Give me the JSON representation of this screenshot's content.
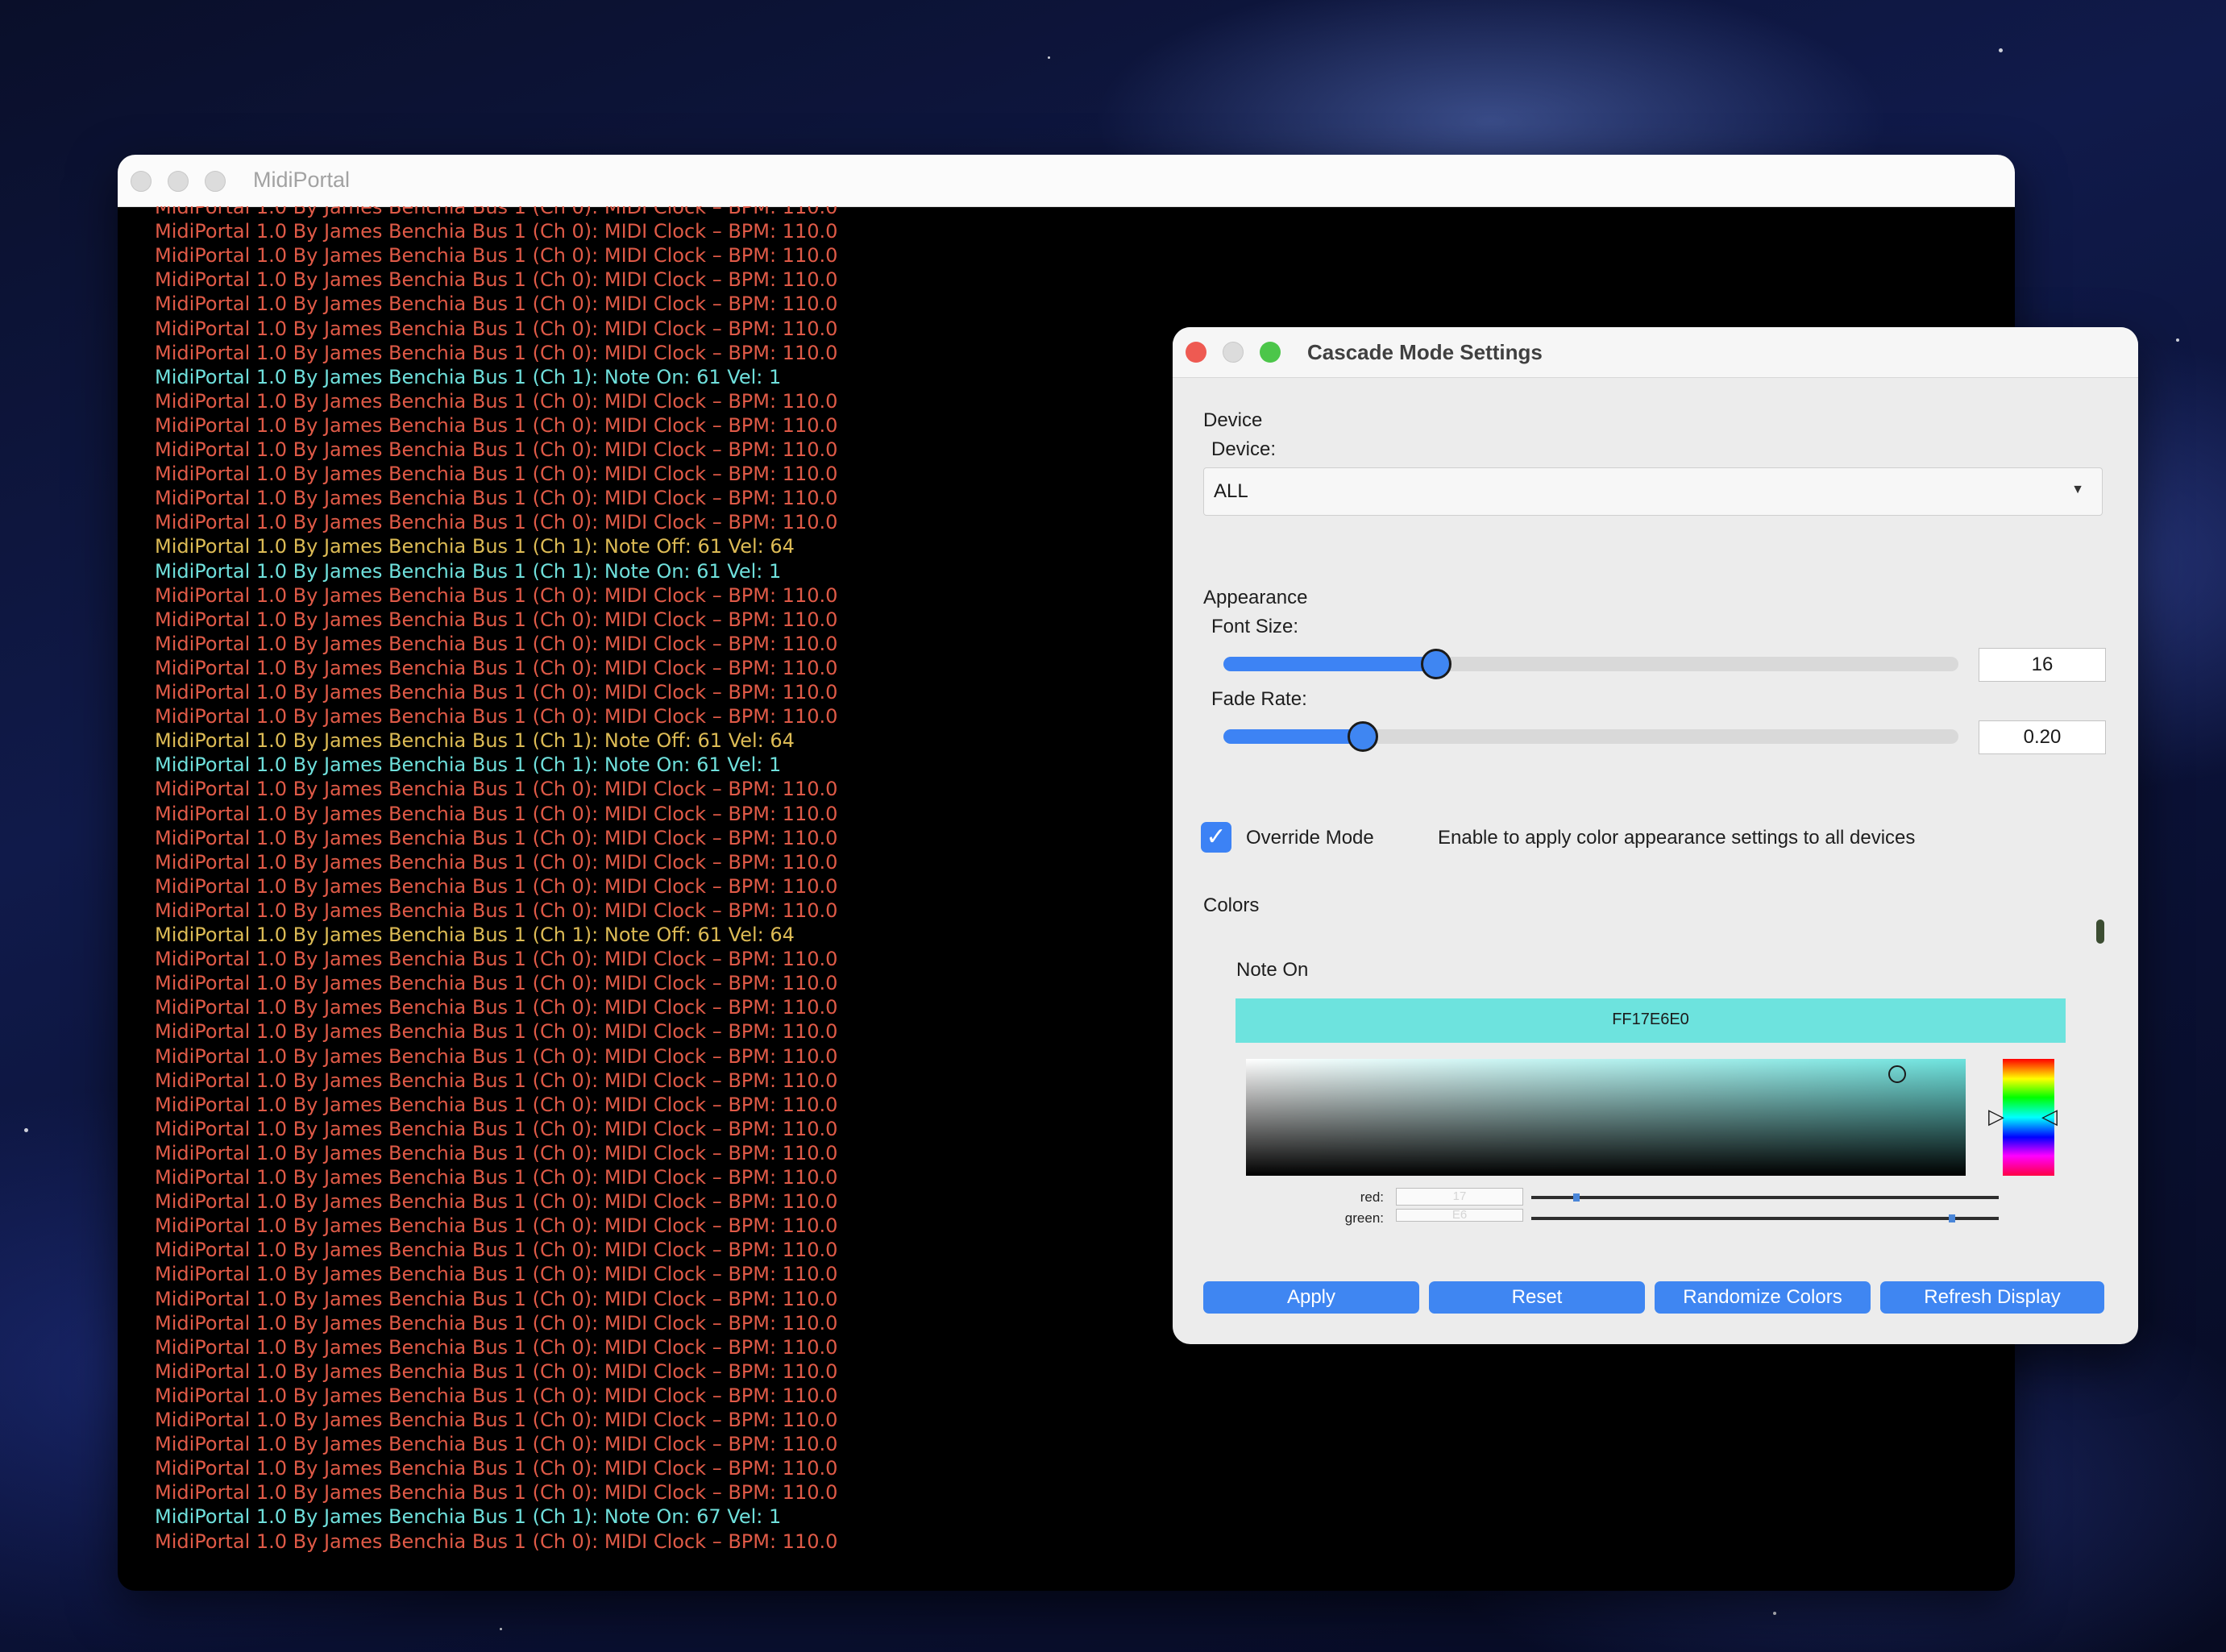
{
  "colors": {
    "clock": "#e05a47",
    "note_on": "#6fe0dc",
    "note_off": "#ddbb55",
    "accent": "#3f86f2"
  },
  "main_window": {
    "title": "MidiPortal",
    "log_lines": [
      {
        "text": "MidiPortal 1.0 By James Benchia Bus 1 (Ch 0): MIDI Clock – BPM: 110.0",
        "type": "clock"
      },
      {
        "text": "MidiPortal 1.0 By James Benchia Bus 1 (Ch 0): MIDI Clock – BPM: 110.0",
        "type": "clock"
      },
      {
        "text": "MidiPortal 1.0 By James Benchia Bus 1 (Ch 0): MIDI Clock – BPM: 110.0",
        "type": "clock"
      },
      {
        "text": "MidiPortal 1.0 By James Benchia Bus 1 (Ch 0): MIDI Clock – BPM: 110.0",
        "type": "clock"
      },
      {
        "text": "MidiPortal 1.0 By James Benchia Bus 1 (Ch 0): MIDI Clock – BPM: 110.0",
        "type": "clock"
      },
      {
        "text": "MidiPortal 1.0 By James Benchia Bus 1 (Ch 0): MIDI Clock – BPM: 110.0",
        "type": "clock"
      },
      {
        "text": "MidiPortal 1.0 By James Benchia Bus 1 (Ch 0): MIDI Clock – BPM: 110.0",
        "type": "clock"
      },
      {
        "text": "MidiPortal 1.0 By James Benchia Bus 1 (Ch 1): Note On: 61 Vel: 1",
        "type": "note_on"
      },
      {
        "text": "MidiPortal 1.0 By James Benchia Bus 1 (Ch 0): MIDI Clock – BPM: 110.0",
        "type": "clock"
      },
      {
        "text": "MidiPortal 1.0 By James Benchia Bus 1 (Ch 0): MIDI Clock – BPM: 110.0",
        "type": "clock"
      },
      {
        "text": "MidiPortal 1.0 By James Benchia Bus 1 (Ch 0): MIDI Clock – BPM: 110.0",
        "type": "clock"
      },
      {
        "text": "MidiPortal 1.0 By James Benchia Bus 1 (Ch 0): MIDI Clock – BPM: 110.0",
        "type": "clock"
      },
      {
        "text": "MidiPortal 1.0 By James Benchia Bus 1 (Ch 0): MIDI Clock – BPM: 110.0",
        "type": "clock"
      },
      {
        "text": "MidiPortal 1.0 By James Benchia Bus 1 (Ch 0): MIDI Clock – BPM: 110.0",
        "type": "clock"
      },
      {
        "text": "MidiPortal 1.0 By James Benchia Bus 1 (Ch 1): Note Off: 61 Vel: 64",
        "type": "note_off"
      },
      {
        "text": "MidiPortal 1.0 By James Benchia Bus 1 (Ch 1): Note On: 61 Vel: 1",
        "type": "note_on"
      },
      {
        "text": "MidiPortal 1.0 By James Benchia Bus 1 (Ch 0): MIDI Clock – BPM: 110.0",
        "type": "clock"
      },
      {
        "text": "MidiPortal 1.0 By James Benchia Bus 1 (Ch 0): MIDI Clock – BPM: 110.0",
        "type": "clock"
      },
      {
        "text": "MidiPortal 1.0 By James Benchia Bus 1 (Ch 0): MIDI Clock – BPM: 110.0",
        "type": "clock"
      },
      {
        "text": "MidiPortal 1.0 By James Benchia Bus 1 (Ch 0): MIDI Clock – BPM: 110.0",
        "type": "clock"
      },
      {
        "text": "MidiPortal 1.0 By James Benchia Bus 1 (Ch 0): MIDI Clock – BPM: 110.0",
        "type": "clock"
      },
      {
        "text": "MidiPortal 1.0 By James Benchia Bus 1 (Ch 0): MIDI Clock – BPM: 110.0",
        "type": "clock"
      },
      {
        "text": "MidiPortal 1.0 By James Benchia Bus 1 (Ch 1): Note Off: 61 Vel: 64",
        "type": "note_off"
      },
      {
        "text": "MidiPortal 1.0 By James Benchia Bus 1 (Ch 1): Note On: 61 Vel: 1",
        "type": "note_on"
      },
      {
        "text": "MidiPortal 1.0 By James Benchia Bus 1 (Ch 0): MIDI Clock – BPM: 110.0",
        "type": "clock"
      },
      {
        "text": "MidiPortal 1.0 By James Benchia Bus 1 (Ch 0): MIDI Clock – BPM: 110.0",
        "type": "clock"
      },
      {
        "text": "MidiPortal 1.0 By James Benchia Bus 1 (Ch 0): MIDI Clock – BPM: 110.0",
        "type": "clock"
      },
      {
        "text": "MidiPortal 1.0 By James Benchia Bus 1 (Ch 0): MIDI Clock – BPM: 110.0",
        "type": "clock"
      },
      {
        "text": "MidiPortal 1.0 By James Benchia Bus 1 (Ch 0): MIDI Clock – BPM: 110.0",
        "type": "clock"
      },
      {
        "text": "MidiPortal 1.0 By James Benchia Bus 1 (Ch 0): MIDI Clock – BPM: 110.0",
        "type": "clock"
      },
      {
        "text": "MidiPortal 1.0 By James Benchia Bus 1 (Ch 1): Note Off: 61 Vel: 64",
        "type": "note_off"
      },
      {
        "text": "MidiPortal 1.0 By James Benchia Bus 1 (Ch 0): MIDI Clock – BPM: 110.0",
        "type": "clock"
      },
      {
        "text": "MidiPortal 1.0 By James Benchia Bus 1 (Ch 0): MIDI Clock – BPM: 110.0",
        "type": "clock"
      },
      {
        "text": "MidiPortal 1.0 By James Benchia Bus 1 (Ch 0): MIDI Clock – BPM: 110.0",
        "type": "clock"
      },
      {
        "text": "MidiPortal 1.0 By James Benchia Bus 1 (Ch 0): MIDI Clock – BPM: 110.0",
        "type": "clock"
      },
      {
        "text": "MidiPortal 1.0 By James Benchia Bus 1 (Ch 0): MIDI Clock – BPM: 110.0",
        "type": "clock"
      },
      {
        "text": "MidiPortal 1.0 By James Benchia Bus 1 (Ch 0): MIDI Clock – BPM: 110.0",
        "type": "clock"
      },
      {
        "text": "MidiPortal 1.0 By James Benchia Bus 1 (Ch 0): MIDI Clock – BPM: 110.0",
        "type": "clock"
      },
      {
        "text": "MidiPortal 1.0 By James Benchia Bus 1 (Ch 0): MIDI Clock – BPM: 110.0",
        "type": "clock"
      },
      {
        "text": "MidiPortal 1.0 By James Benchia Bus 1 (Ch 0): MIDI Clock – BPM: 110.0",
        "type": "clock"
      },
      {
        "text": "MidiPortal 1.0 By James Benchia Bus 1 (Ch 0): MIDI Clock – BPM: 110.0",
        "type": "clock"
      },
      {
        "text": "MidiPortal 1.0 By James Benchia Bus 1 (Ch 0): MIDI Clock – BPM: 110.0",
        "type": "clock"
      },
      {
        "text": "MidiPortal 1.0 By James Benchia Bus 1 (Ch 0): MIDI Clock – BPM: 110.0",
        "type": "clock"
      },
      {
        "text": "MidiPortal 1.0 By James Benchia Bus 1 (Ch 0): MIDI Clock – BPM: 110.0",
        "type": "clock"
      },
      {
        "text": "MidiPortal 1.0 By James Benchia Bus 1 (Ch 0): MIDI Clock – BPM: 110.0",
        "type": "clock"
      },
      {
        "text": "MidiPortal 1.0 By James Benchia Bus 1 (Ch 0): MIDI Clock – BPM: 110.0",
        "type": "clock"
      },
      {
        "text": "MidiPortal 1.0 By James Benchia Bus 1 (Ch 0): MIDI Clock – BPM: 110.0",
        "type": "clock"
      },
      {
        "text": "MidiPortal 1.0 By James Benchia Bus 1 (Ch 0): MIDI Clock – BPM: 110.0",
        "type": "clock"
      },
      {
        "text": "MidiPortal 1.0 By James Benchia Bus 1 (Ch 0): MIDI Clock – BPM: 110.0",
        "type": "clock"
      },
      {
        "text": "MidiPortal 1.0 By James Benchia Bus 1 (Ch 0): MIDI Clock – BPM: 110.0",
        "type": "clock"
      },
      {
        "text": "MidiPortal 1.0 By James Benchia Bus 1 (Ch 0): MIDI Clock – BPM: 110.0",
        "type": "clock"
      },
      {
        "text": "MidiPortal 1.0 By James Benchia Bus 1 (Ch 0): MIDI Clock – BPM: 110.0",
        "type": "clock"
      },
      {
        "text": "MidiPortal 1.0 By James Benchia Bus 1 (Ch 0): MIDI Clock – BPM: 110.0",
        "type": "clock"
      },
      {
        "text": "MidiPortal 1.0 By James Benchia Bus 1 (Ch 0): MIDI Clock – BPM: 110.0",
        "type": "clock"
      },
      {
        "text": "MidiPortal 1.0 By James Benchia Bus 1 (Ch 1): Note On: 67 Vel: 1",
        "type": "note_on"
      },
      {
        "text": "MidiPortal 1.0 By James Benchia Bus 1 (Ch 0): MIDI Clock – BPM: 110.0",
        "type": "clock"
      }
    ]
  },
  "dialog": {
    "title": "Cascade Mode Settings",
    "device_section": "Device",
    "device_label": "Device:",
    "device_value": "ALL",
    "appearance_section": "Appearance",
    "font_size_label": "Font Size:",
    "font_size_value": "16",
    "font_size_fraction": 0.29,
    "fade_rate_label": "Fade Rate:",
    "fade_rate_value": "0.20",
    "fade_rate_fraction": 0.19,
    "override_label": "Override Mode",
    "override_checked": true,
    "override_hint": "Enable to apply color appearance settings to all devices",
    "colors_section": "Colors",
    "color_item_label": "Note On",
    "color_hex": "FF17E6E0",
    "red_label": "red:",
    "red_value": "17",
    "green_label": "green:",
    "green_value": "E6",
    "buttons": {
      "apply": "Apply",
      "reset": "Reset",
      "randomize": "Randomize Colors",
      "refresh": "Refresh Display"
    }
  }
}
